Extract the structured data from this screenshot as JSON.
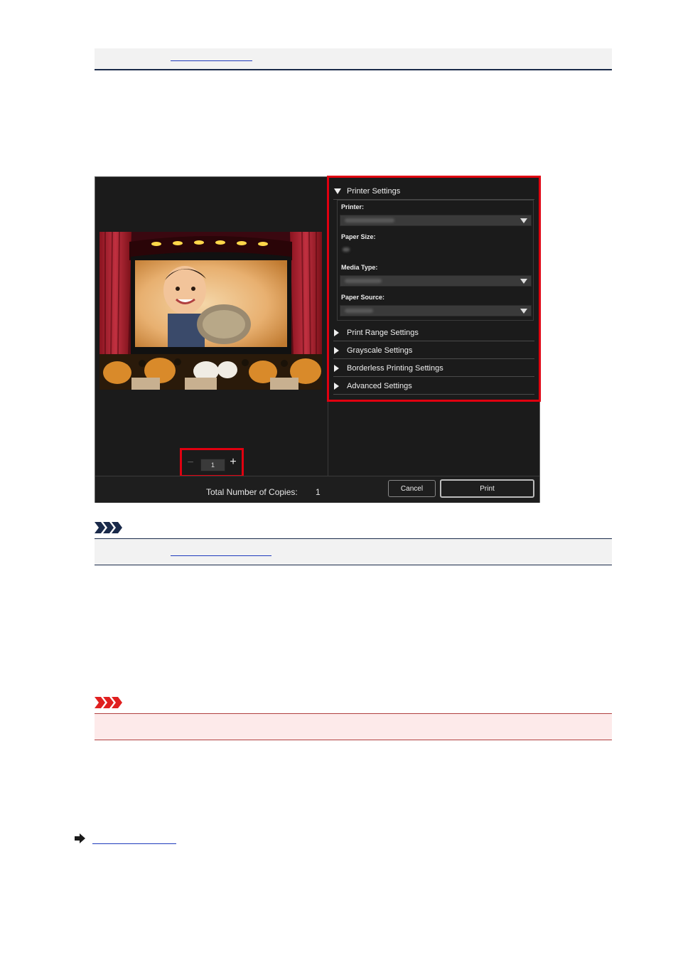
{
  "dialog": {
    "settings_sections": [
      {
        "label": "Printer Settings",
        "expanded": true
      },
      {
        "label": "Print Range Settings",
        "expanded": false
      },
      {
        "label": "Grayscale Settings",
        "expanded": false
      },
      {
        "label": "Borderless Printing Settings",
        "expanded": false
      },
      {
        "label": "Advanced Settings",
        "expanded": false
      }
    ],
    "fields": {
      "printer_label": "Printer:",
      "paper_size_label": "Paper Size:",
      "media_type_label": "Media Type:",
      "paper_source_label": "Paper Source:"
    },
    "copies": {
      "minus": "−",
      "value": "1",
      "plus": "+"
    },
    "total_copies_label": "Total Number of Copies:",
    "total_copies_value": "1",
    "cancel_label": "Cancel",
    "print_label": "Print"
  },
  "colors": {
    "highlight": "#e00010",
    "dialog_bg": "#1b1b1b",
    "note_accent": "#1a2a4a",
    "important_accent": "#e02020"
  }
}
